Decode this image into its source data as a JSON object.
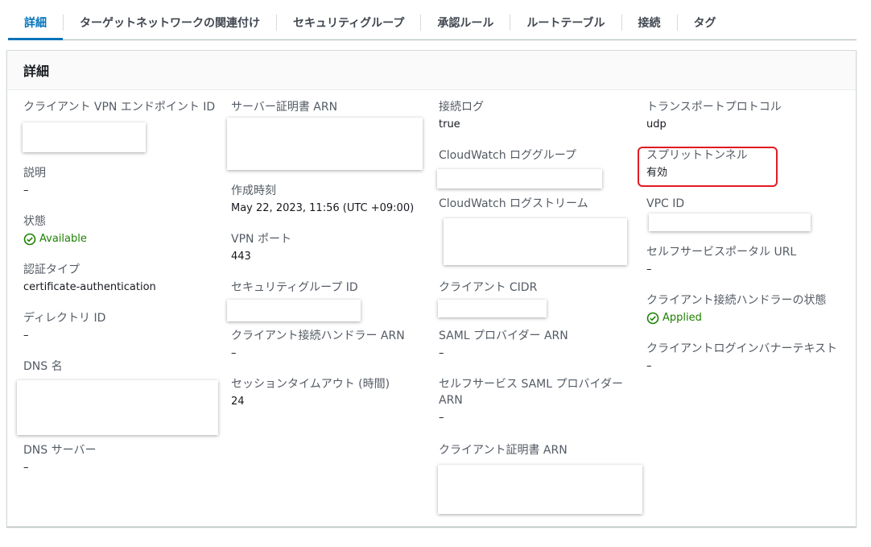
{
  "tabs": [
    {
      "label": "詳細",
      "active": true
    },
    {
      "label": "ターゲットネットワークの関連付け"
    },
    {
      "label": "セキュリティグループ"
    },
    {
      "label": "承認ルール"
    },
    {
      "label": "ルートテーブル"
    },
    {
      "label": "接続"
    },
    {
      "label": "タグ"
    }
  ],
  "panel": {
    "title": "詳細"
  },
  "col1": {
    "endpoint_id_label": "クライアント VPN エンドポイント ID",
    "description_label": "説明",
    "description_value": "–",
    "status_label": "状態",
    "status_value": "Available",
    "auth_type_label": "認証タイプ",
    "auth_type_value": "certificate-authentication",
    "directory_id_label": "ディレクトリ ID",
    "directory_id_value": "–",
    "dns_name_label": "DNS 名",
    "dns_server_label": "DNS サーバー",
    "dns_server_value": "–"
  },
  "col2": {
    "server_cert_label": "サーバー証明書 ARN",
    "created_label": "作成時刻",
    "created_value": "May 22, 2023, 11:56 (UTC +09:00)",
    "vpn_port_label": "VPN ポート",
    "vpn_port_value": "443",
    "sg_id_label": "セキュリティグループ ID",
    "handler_arn_label": "クライアント接続ハンドラー ARN",
    "handler_arn_value": "–",
    "session_timeout_label": "セッションタイムアウト (時間)",
    "session_timeout_value": "24"
  },
  "col3": {
    "conn_log_label": "接続ログ",
    "conn_log_value": "true",
    "cw_group_label": "CloudWatch ロググループ",
    "cw_stream_label": "CloudWatch ログストリーム",
    "client_cidr_label": "クライアント CIDR",
    "saml_label": "SAML プロバイダー ARN",
    "saml_value": "–",
    "self_saml_label": "セルフサービス SAML プロバイダー ARN",
    "self_saml_value": "–",
    "client_cert_label": "クライアント証明書 ARN"
  },
  "col4": {
    "transport_label": "トランスポートプロトコル",
    "transport_value": "udp",
    "split_label": "スプリットトンネル",
    "split_value": "有効",
    "vpc_label": "VPC ID",
    "portal_label": "セルフサービスポータル URL",
    "portal_value": "–",
    "handler_status_label": "クライアント接続ハンドラーの状態",
    "handler_status_value": "Applied",
    "banner_label": "クライアントログインバナーテキスト",
    "banner_value": "–"
  },
  "colors": {
    "accent": "#0073bb",
    "success": "#1d8102",
    "highlight": "#e01b24"
  }
}
